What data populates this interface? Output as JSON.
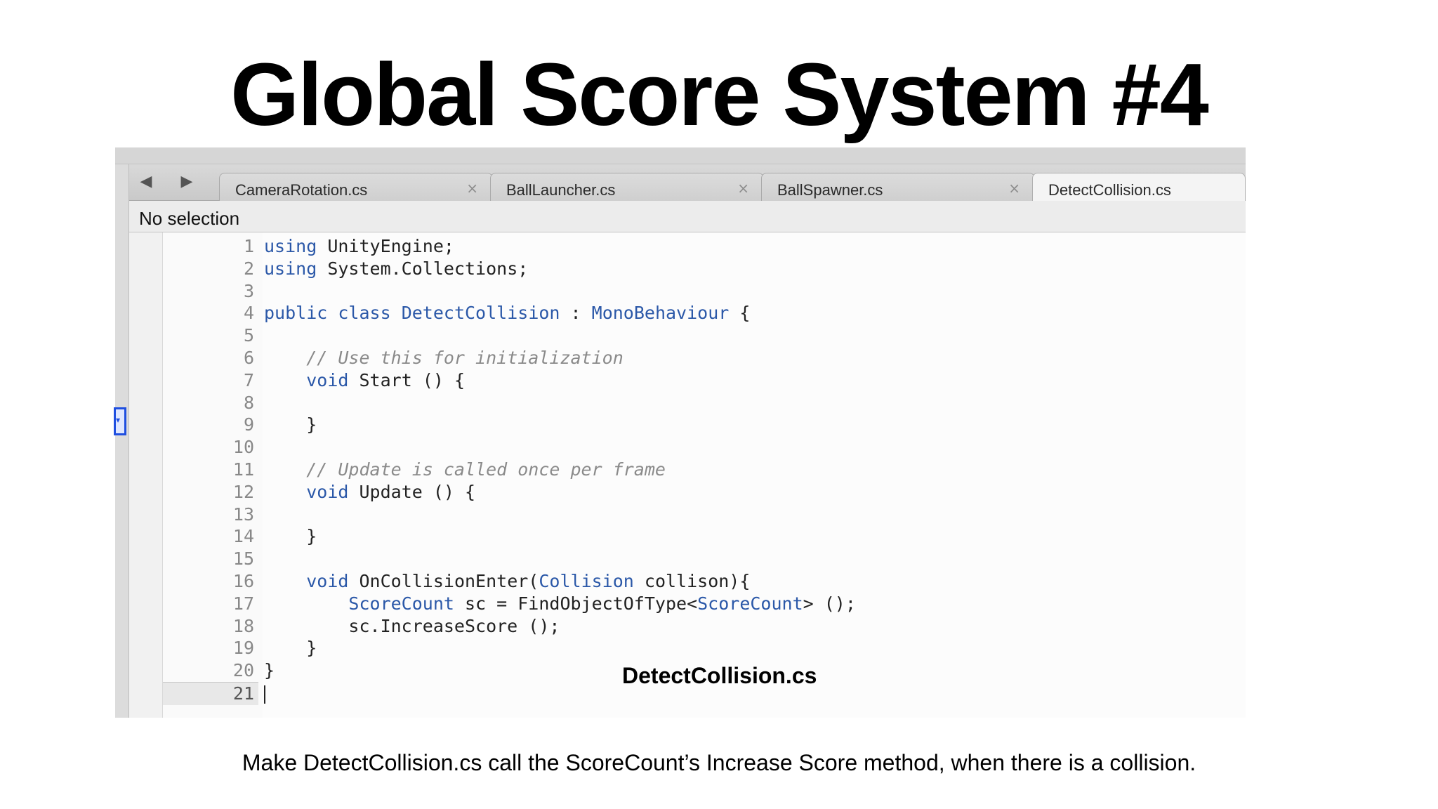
{
  "slide": {
    "title": "Global Score System #4",
    "file_caption": "DetectCollision.cs",
    "footer": "Make DetectCollision.cs call the ScoreCount’s Increase Score method, when there is a collision."
  },
  "editor": {
    "nav": {
      "back_glyph": "◀",
      "forward_glyph": "▶"
    },
    "tabs": [
      {
        "label": "CameraRotation.cs",
        "close": "×"
      },
      {
        "label": "BallLauncher.cs",
        "close": "×"
      },
      {
        "label": "BallSpawner.cs",
        "close": "×"
      },
      {
        "label": "DetectCollision.cs",
        "active": true
      }
    ],
    "selection_status": "No selection",
    "code": {
      "line_numbers": [
        "1",
        "2",
        "3",
        "4",
        "5",
        "6",
        "7",
        "8",
        "9",
        "10",
        "11",
        "12",
        "13",
        "14",
        "15",
        "16",
        "17",
        "18",
        "19",
        "20",
        "21"
      ],
      "lines": [
        "using UnityEngine;",
        "using System.Collections;",
        "",
        "public class DetectCollision : MonoBehaviour {",
        "",
        "    // Use this for initialization",
        "    void Start () {",
        "",
        "    }",
        "",
        "    // Update is called once per frame",
        "    void Update () {",
        "",
        "    }",
        "",
        "    void OnCollisionEnter(Collision collison){",
        "        ScoreCount sc = FindObjectOfType<ScoreCount> ();",
        "        sc.IncreaseScore ();",
        "    }",
        "}",
        ""
      ]
    }
  },
  "colors": {
    "keyword": "#2b58a8",
    "comment": "#8a8a8a",
    "marker": "#1f4fe0"
  }
}
